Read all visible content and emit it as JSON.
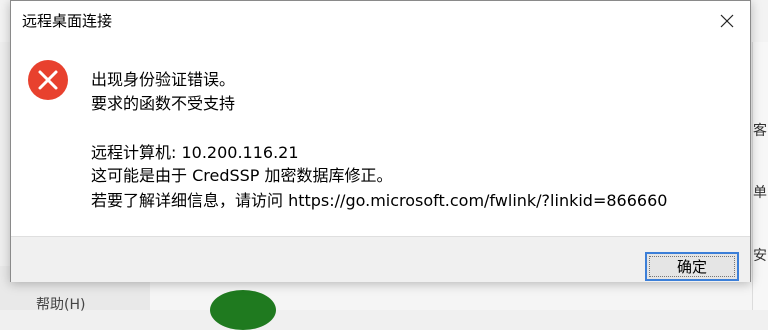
{
  "dialog": {
    "title": "远程桌面连接",
    "messages": {
      "line1": "出现身份验证错误。",
      "line2": "要求的函数不受支持",
      "line3": "远程计算机: 10.200.116.21",
      "line4": "这可能是由于 CredSSP 加密数据库修正。",
      "line5": "若要了解详细信息，请访问 https://go.microsoft.com/fwlink/?linkid=866660"
    },
    "ok_label": "确定",
    "icon": "error-icon",
    "close_icon": "close-icon"
  },
  "background": {
    "help_menu": "帮助(H)",
    "right_glyphs": [
      "客",
      "单",
      "安"
    ]
  },
  "colors": {
    "error_red": "#e8412e",
    "focus_blue": "#3c7fd8"
  }
}
